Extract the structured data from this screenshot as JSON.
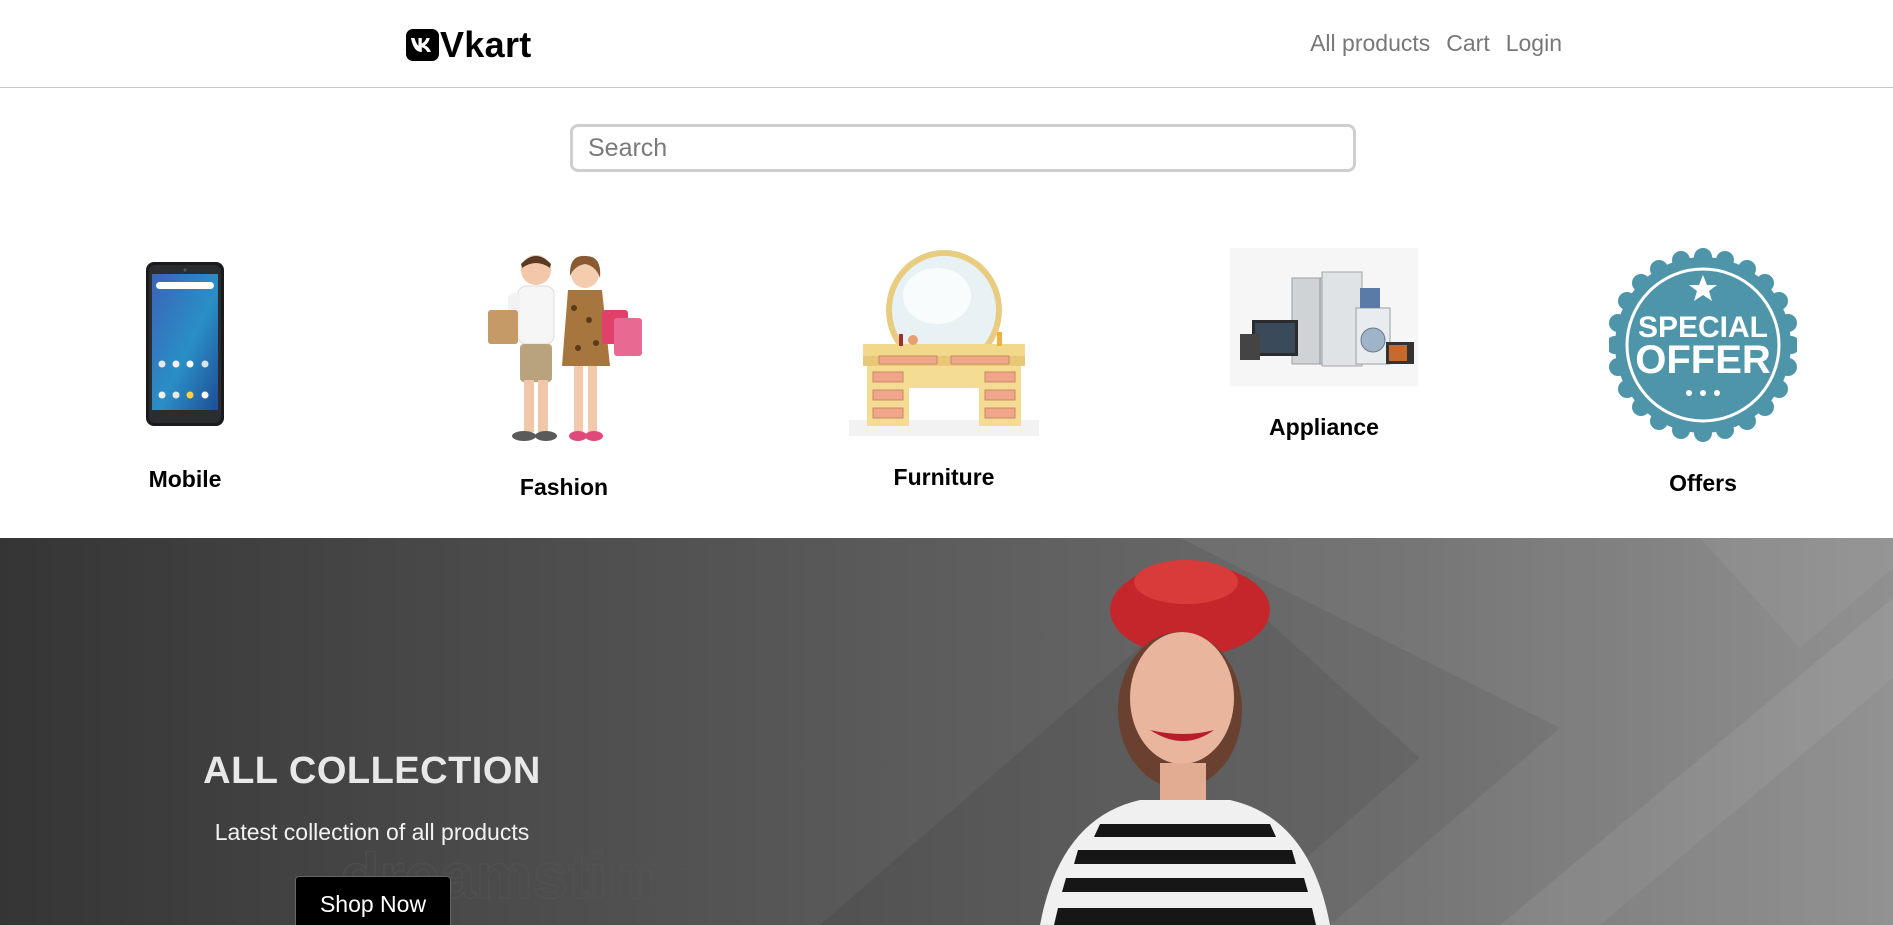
{
  "header": {
    "brand": "Vkart",
    "links": [
      "All products",
      "Cart",
      "Login"
    ]
  },
  "search": {
    "placeholder": "Search",
    "value": ""
  },
  "categories": [
    {
      "label": "Mobile",
      "icon": "mobile-phone-image"
    },
    {
      "label": "Fashion",
      "icon": "fashion-kids-image"
    },
    {
      "label": "Furniture",
      "icon": "dressing-table-image"
    },
    {
      "label": "Appliance",
      "icon": "appliances-image"
    },
    {
      "label": "Offers",
      "icon": "special-offer-badge-image"
    }
  ],
  "offer_badge": {
    "line1": "SPECIAL",
    "line2": "OFFER"
  },
  "banner": {
    "title": "ALL COLLECTION",
    "subtitle": "Latest collection of all products",
    "button": "Shop Now",
    "watermark": "dreamstime"
  },
  "colors": {
    "nav_link": "#777777",
    "badge": "#4f95aa",
    "beret": "#d42a2a"
  }
}
